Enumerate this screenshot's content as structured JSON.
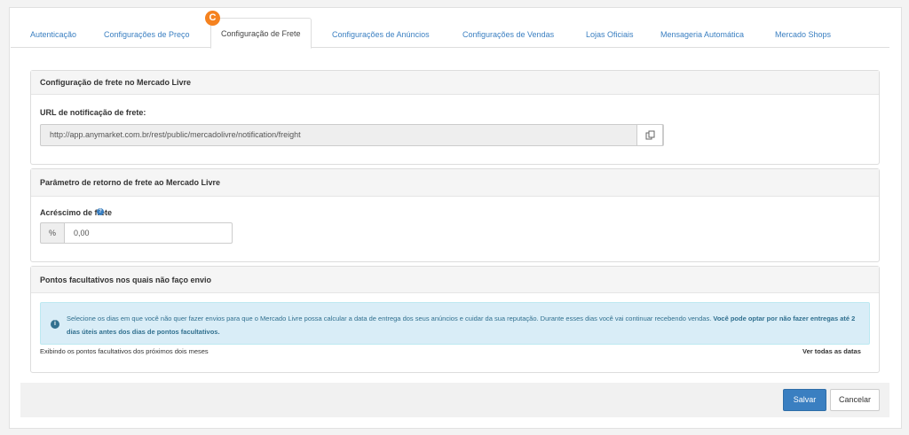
{
  "tabs": [
    {
      "label": "Autenticação",
      "active": false
    },
    {
      "label": "Configurações de Preço",
      "active": false
    },
    {
      "label": "Configuração de Frete",
      "active": true
    },
    {
      "label": "Configurações de Anúncios",
      "active": false
    },
    {
      "label": "Configurações de Vendas",
      "active": false
    },
    {
      "label": "Lojas Oficiais",
      "active": false
    },
    {
      "label": "Mensageria Automática",
      "active": false
    },
    {
      "label": "Mercado Shops",
      "active": false
    }
  ],
  "badge": "C",
  "freight_panel": {
    "title": "Configuração de frete no Mercado Livre",
    "url_label": "URL de notificação de frete:",
    "url_value": "http://app.anymarket.com.br/rest/public/mercadolivre/notification/freight"
  },
  "return_panel": {
    "title": "Parâmetro de retorno de frete ao Mercado Livre",
    "surcharge_label": "Acréscimo de frete",
    "addon": "%",
    "surcharge_value": "0,00"
  },
  "holidays_panel": {
    "title": "Pontos facultativos nos quais não faço envio",
    "info_text": "Selecione os dias em que você não quer fazer envios para que o Mercado Livre possa calcular a data de entrega dos seus anúncios e cuidar da sua reputação. Durante esses dias você vai continuar recebendo vendas.",
    "info_bold": "Você pode optar por não fazer entregas até 2 dias úteis antes dos dias de pontos facultativos.",
    "showing_text": "Exibindo os pontos facultativos dos próximos dois meses",
    "view_all": "Ver todas as datas"
  },
  "footer": {
    "save_label": "Salvar",
    "cancel_label": "Cancelar"
  },
  "colors": {
    "accent": "#3a7fc1",
    "badge": "#f5821f",
    "alert_bg": "#d9edf7",
    "alert_text": "#31708f"
  }
}
